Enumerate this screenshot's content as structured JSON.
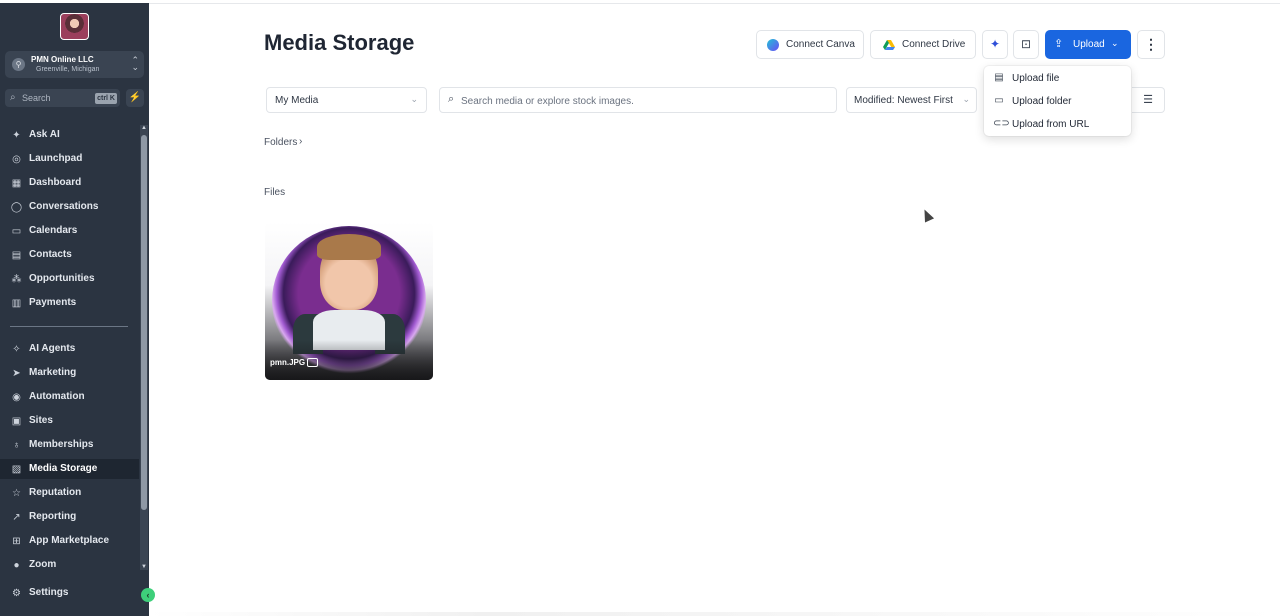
{
  "sidebar": {
    "account": {
      "name": "PMN Online LLC",
      "location": "Greenville, Michigan"
    },
    "search": {
      "placeholder": "Search",
      "shortcut": "ctrl K"
    },
    "items": [
      {
        "label": "Ask AI",
        "icon": "sparkle-icon"
      },
      {
        "label": "Launchpad",
        "icon": "launchpad-icon"
      },
      {
        "label": "Dashboard",
        "icon": "dashboard-icon"
      },
      {
        "label": "Conversations",
        "icon": "chat-icon"
      },
      {
        "label": "Calendars",
        "icon": "calendar-icon"
      },
      {
        "label": "Contacts",
        "icon": "contacts-icon"
      },
      {
        "label": "Opportunities",
        "icon": "opportunities-icon"
      },
      {
        "label": "Payments",
        "icon": "payments-icon"
      },
      {
        "label": "AI Agents",
        "icon": "ai-agents-icon"
      },
      {
        "label": "Marketing",
        "icon": "send-icon"
      },
      {
        "label": "Automation",
        "icon": "automation-icon"
      },
      {
        "label": "Sites",
        "icon": "sites-icon"
      },
      {
        "label": "Memberships",
        "icon": "memberships-icon"
      },
      {
        "label": "Media Storage",
        "icon": "media-icon",
        "active": true
      },
      {
        "label": "Reputation",
        "icon": "star-icon"
      },
      {
        "label": "Reporting",
        "icon": "reporting-icon"
      },
      {
        "label": "App Marketplace",
        "icon": "grid-icon"
      },
      {
        "label": "Zoom",
        "icon": "zoom-icon"
      },
      {
        "label": "Settings",
        "icon": "gear-icon"
      }
    ]
  },
  "main": {
    "title": "Media Storage",
    "toolbar": {
      "connect_canva": "Connect Canva",
      "connect_drive": "Connect Drive",
      "upload": "Upload"
    },
    "filters": {
      "media_select": "My Media",
      "search_placeholder": "Search media or explore stock images.",
      "sort": "Modified: Newest First"
    },
    "folders_label": "Folders",
    "files_label": "Files",
    "files": [
      {
        "name": "pmn.JPG",
        "type": "image"
      }
    ],
    "upload_menu": [
      {
        "label": "Upload file",
        "icon": "file-icon"
      },
      {
        "label": "Upload folder",
        "icon": "folder-icon"
      },
      {
        "label": "Upload from URL",
        "icon": "link-icon"
      }
    ]
  },
  "colors": {
    "sidebar_bg": "#2b3441",
    "accent": "#1a66e0",
    "active_item_bg": "#1e2631"
  }
}
